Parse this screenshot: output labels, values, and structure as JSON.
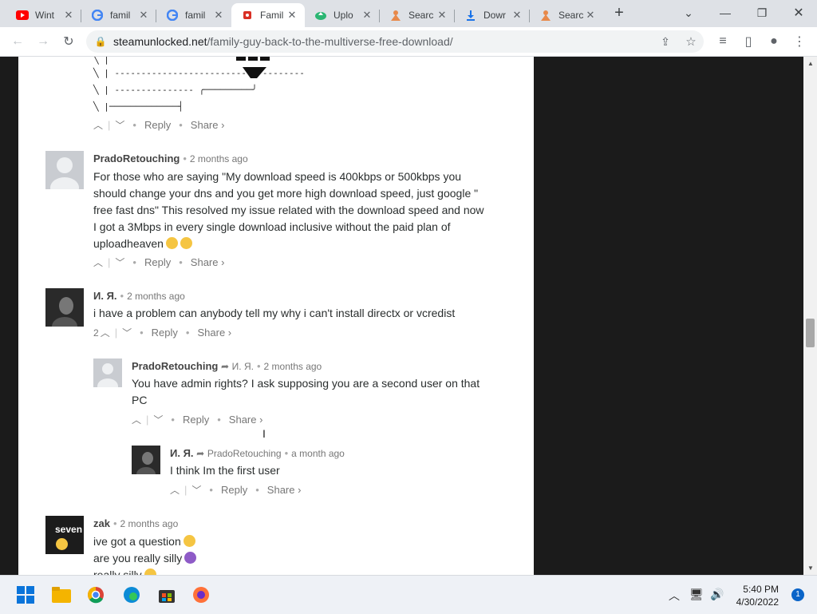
{
  "tabs": [
    {
      "title": "Wint",
      "icon": "youtube-icon",
      "color": "#ff0000"
    },
    {
      "title": "famil",
      "icon": "google-icon",
      "color": "#4285f4"
    },
    {
      "title": "famil",
      "icon": "google-icon",
      "color": "#4285f4"
    },
    {
      "title": "Famil",
      "icon": "site-favicon",
      "color": "#d93025",
      "active": true
    },
    {
      "title": "Uplo",
      "icon": "upload-cloud-icon",
      "color": "#2bb673"
    },
    {
      "title": "Searc",
      "icon": "person-icon",
      "color": "#e8894a"
    },
    {
      "title": "Dowr",
      "icon": "download-icon",
      "color": "#1a73e8"
    },
    {
      "title": "Searc",
      "icon": "person-icon",
      "color": "#e8894a"
    }
  ],
  "toolbar": {
    "url_domain": "steamunlocked.net",
    "url_path": "/family-guy-back-to-the-multiverse-free-download/"
  },
  "ascii_art": {
    "line1": "╲ |",
    "line2": "╲ | ------------------------------------",
    "line3": "╲ | --------------- ╭─────────╯",
    "line4": "╲ |─────────────┤"
  },
  "actions": {
    "reply": "Reply",
    "share": "Share ›"
  },
  "comments": [
    {
      "author": "PradoRetouching",
      "time": "2 months ago",
      "body_lines": [
        "For those who are saying \"My download speed is 400kbps or 500kbps you",
        "should change your dns and you get more high download speed, just google \"",
        "free fast dns\" This resolved my issue related with the download speed and now",
        "I got a 3Mbps in every single download inclusive without the paid plan of",
        "uploadheaven"
      ]
    },
    {
      "author": "И. Я.",
      "time": "2 months ago",
      "body": "i have a problem can anybody tell my why i can't install directx or vcredist",
      "votes": "2"
    },
    {
      "author": "PradoRetouching",
      "reply_to": "И. Я.",
      "time": "2 months ago",
      "body_lines": [
        "You have admin rights? I ask supposing you are a second user on that",
        "PC"
      ]
    },
    {
      "author": "И. Я.",
      "reply_to": "PradoRetouching",
      "time": "a month ago",
      "body": "I think Im the first user"
    },
    {
      "author": "zak",
      "time": "2 months ago",
      "body_lines": [
        "ive got a question",
        "are you really silly",
        "really silly"
      ],
      "avatar_text": "seven"
    }
  ],
  "taskbar": {
    "time": "5:40 PM",
    "date": "4/30/2022",
    "notifications": "1"
  },
  "colors": {
    "tabbar": "#dee1e6",
    "page_bg": "#ffffff",
    "sidebar_dark": "#1b1b1b"
  }
}
